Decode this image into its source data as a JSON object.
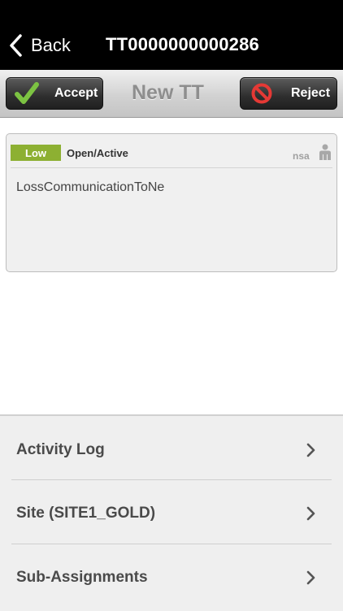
{
  "navbar": {
    "back_label": "Back",
    "title": "TT0000000000286"
  },
  "toolbar": {
    "accept_label": "Accept",
    "title": "New TT",
    "reject_label": "Reject"
  },
  "ticket": {
    "priority": "Low",
    "status": "Open/Active",
    "tag": "nsa",
    "description": "LossCommunicationToNe"
  },
  "menu": {
    "items": [
      {
        "label": "Activity Log"
      },
      {
        "label": "Site (SITE1_GOLD)"
      },
      {
        "label": "Sub-Assignments"
      }
    ]
  },
  "colors": {
    "priority_low": "#8db032",
    "accept_check": "#7cc242",
    "reject_icon": "#e53935"
  }
}
